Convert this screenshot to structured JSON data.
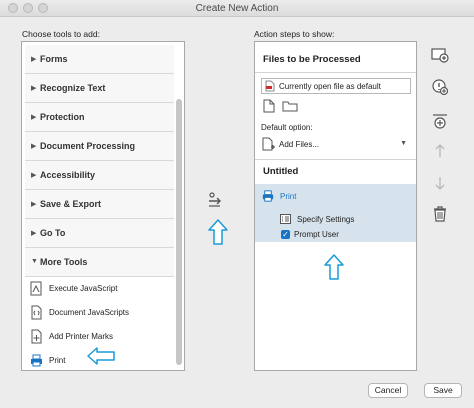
{
  "window": {
    "title": "Create New Action"
  },
  "left": {
    "label": "Choose tools to add:",
    "categories": [
      {
        "label": "Forms"
      },
      {
        "label": "Recognize Text"
      },
      {
        "label": "Protection"
      },
      {
        "label": "Document Processing"
      },
      {
        "label": "Accessibility"
      },
      {
        "label": "Save & Export"
      },
      {
        "label": "Go To"
      },
      {
        "label": "More Tools"
      }
    ],
    "tools": [
      {
        "label": "Execute JavaScript",
        "icon": "javascript-icon"
      },
      {
        "label": "Document JavaScripts",
        "icon": "document-javascript-icon"
      },
      {
        "label": "Add Printer Marks",
        "icon": "printer-marks-icon"
      },
      {
        "label": "Print",
        "icon": "printer-icon"
      }
    ]
  },
  "right": {
    "label": "Action steps to show:",
    "files_header": "Files to be Processed",
    "file_source": "Currently open file as default",
    "default_option_label": "Default option:",
    "add_files": "Add Files...",
    "group_title": "Untitled",
    "step": {
      "name": "Print",
      "specify_settings": "Specify Settings",
      "prompt_user": "Prompt User",
      "prompt_user_checked": true
    }
  },
  "buttons": {
    "cancel": "Cancel",
    "save": "Save"
  },
  "colors": {
    "accent": "#1a74c4",
    "selection": "#d7e3ec",
    "arrow": "#1a9bd7"
  }
}
